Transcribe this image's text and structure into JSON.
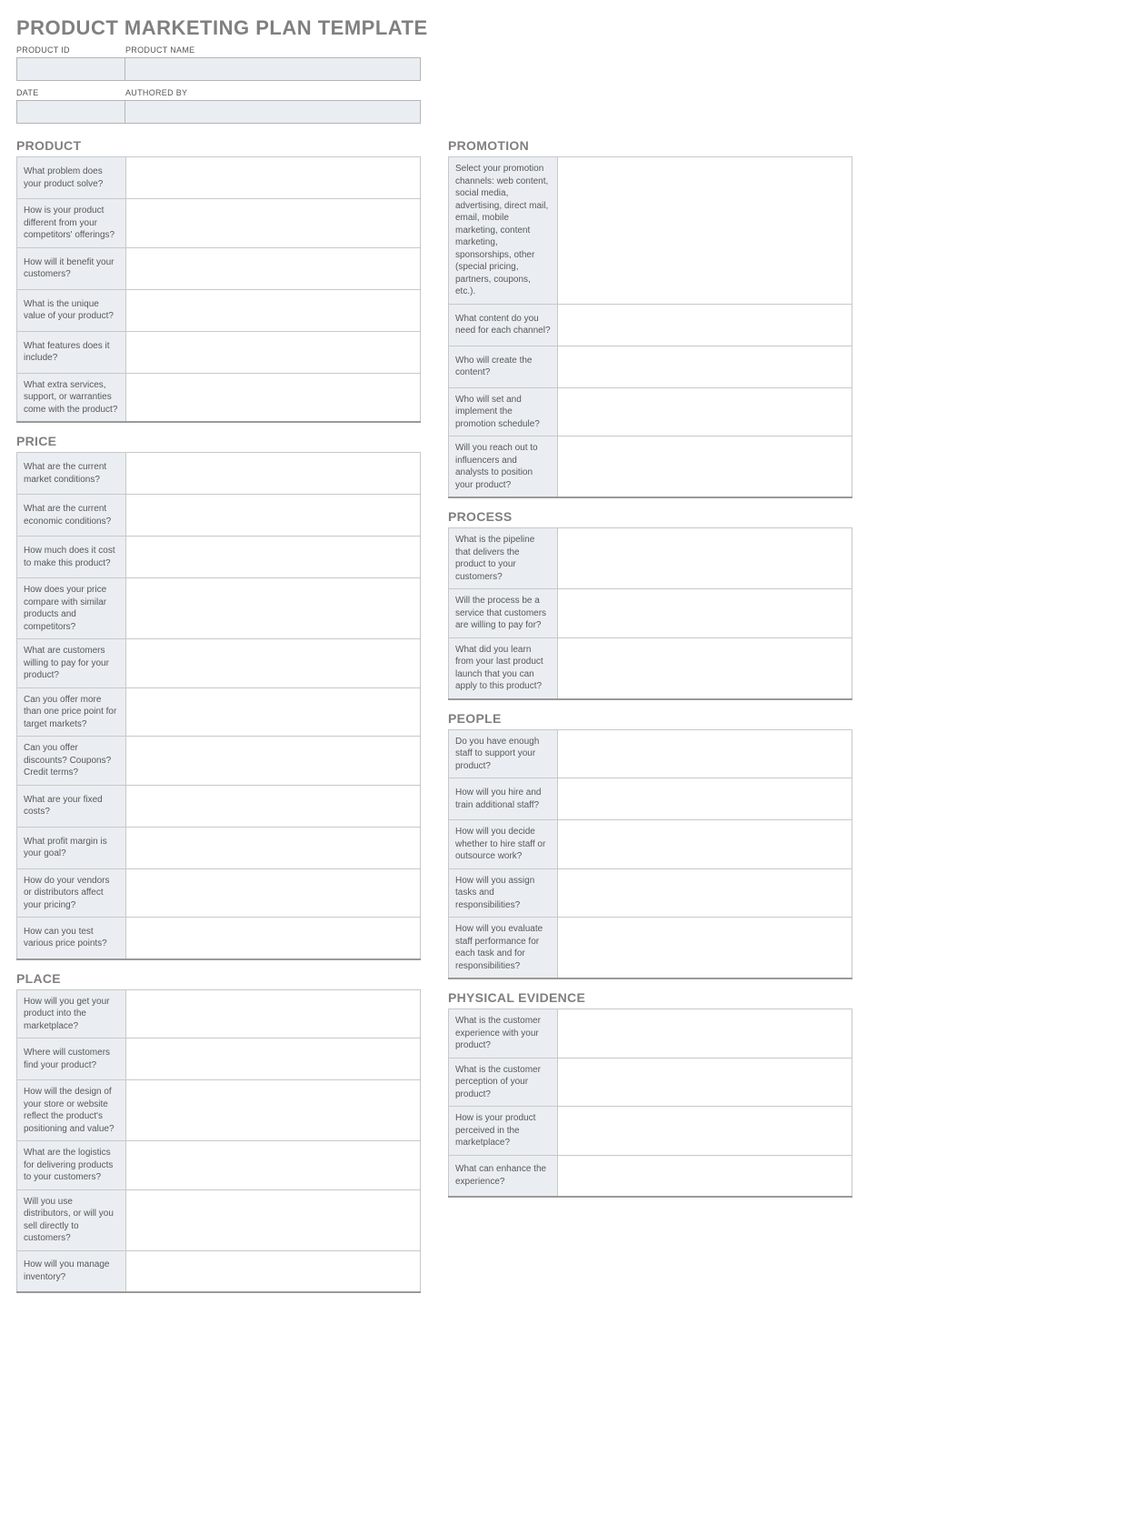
{
  "title": "PRODUCT MARKETING PLAN TEMPLATE",
  "meta": {
    "row1": [
      {
        "label": "PRODUCT ID",
        "size": "small",
        "value": ""
      },
      {
        "label": "PRODUCT NAME",
        "size": "large",
        "value": ""
      }
    ],
    "row2": [
      {
        "label": "DATE",
        "size": "small",
        "value": ""
      },
      {
        "label": "AUTHORED BY",
        "size": "large",
        "value": ""
      }
    ]
  },
  "sections": {
    "left": [
      {
        "heading": "PRODUCT",
        "rows": [
          {
            "q": "What problem does your product solve?"
          },
          {
            "q": "How is your product different from your competitors' offerings?"
          },
          {
            "q": "How will it benefit your customers?"
          },
          {
            "q": "What is the unique value of your product?"
          },
          {
            "q": "What features does it include?"
          },
          {
            "q": "What extra services, support, or warranties come with the product?"
          }
        ]
      },
      {
        "heading": "PRICE",
        "rows": [
          {
            "q": "What are the current market conditions?"
          },
          {
            "q": "What are the current economic conditions?"
          },
          {
            "q": "How much does it cost to make this product?"
          },
          {
            "q": "How does your price compare with similar products and competitors?"
          },
          {
            "q": "What are customers willing to pay for your product?"
          },
          {
            "q": "Can you offer more than one price point for target markets?"
          },
          {
            "q": "Can you offer discounts? Coupons? Credit terms?"
          },
          {
            "q": "What are your fixed costs?"
          },
          {
            "q": "What profit margin is your goal?"
          },
          {
            "q": "How do your vendors or distributors affect your pricing?"
          },
          {
            "q": "How can you test various price points?"
          }
        ]
      },
      {
        "heading": "PLACE",
        "rows": [
          {
            "q": "How will you get your product into the marketplace?"
          },
          {
            "q": "Where will customers find your product?"
          },
          {
            "q": "How will the design of your store or website reflect the product's positioning and value?"
          },
          {
            "q": "What are the logistics for delivering products to your customers?"
          },
          {
            "q": "Will you use distributors, or will you sell directly to customers?"
          },
          {
            "q": "How will you manage inventory?"
          }
        ]
      }
    ],
    "right": [
      {
        "heading": "PROMOTION",
        "rows": [
          {
            "q": "Select your promotion channels: web content, social media, advertising, direct mail, email, mobile marketing, content marketing, sponsorships, other (special pricing, partners, coupons, etc.).",
            "long": true
          },
          {
            "q": "What content do you need for each channel?"
          },
          {
            "q": "Who will create the content?"
          },
          {
            "q": "Who will set and implement the promotion schedule?"
          },
          {
            "q": "Will you reach out to influencers and analysts to position your product?"
          }
        ]
      },
      {
        "heading": "PROCESS",
        "rows": [
          {
            "q": "What is the pipeline that delivers the product to your customers?"
          },
          {
            "q": "Will the process be a service that customers are willing to pay for?"
          },
          {
            "q": "What did you learn from your last product launch that you can apply to this product?"
          }
        ]
      },
      {
        "heading": "PEOPLE",
        "rows": [
          {
            "q": "Do you have enough staff to support your product?"
          },
          {
            "q": "How will you hire and train additional staff?"
          },
          {
            "q": "How will you decide whether to hire staff or outsource work?"
          },
          {
            "q": "How will you assign tasks and responsibilities?"
          },
          {
            "q": "How will you evaluate staff performance for each task and for responsibilities?"
          }
        ]
      },
      {
        "heading": "PHYSICAL EVIDENCE",
        "rows": [
          {
            "q": "What is the customer experience with your product?"
          },
          {
            "q": "What is the customer perception of your product?"
          },
          {
            "q": "How is your product perceived in the marketplace?"
          },
          {
            "q": "What can enhance the experience?"
          }
        ]
      }
    ]
  }
}
